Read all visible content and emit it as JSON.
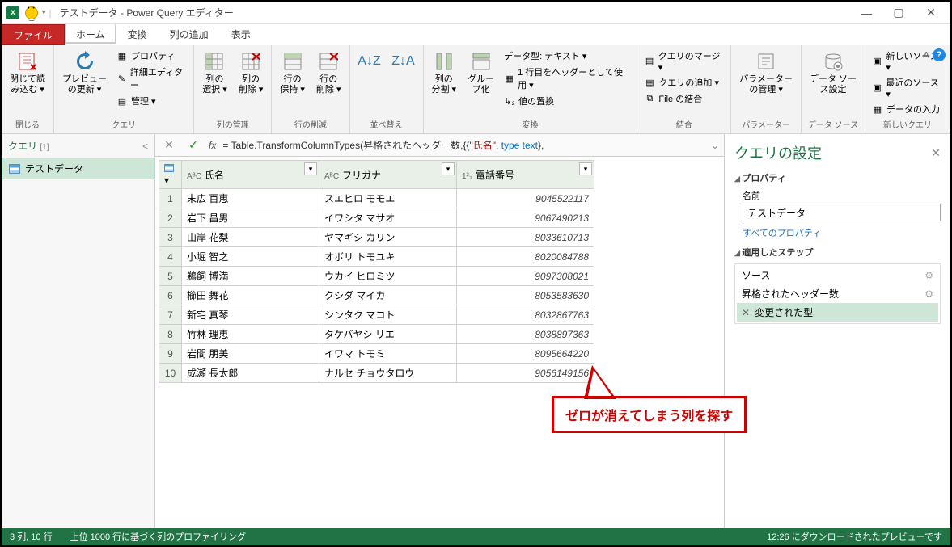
{
  "app": {
    "title": "テストデータ - Power Query エディター"
  },
  "win": {
    "min": "—",
    "max": "▢",
    "close": "✕"
  },
  "tabs": {
    "file": "ファイル",
    "home": "ホーム",
    "transform": "変換",
    "addcol": "列の追加",
    "view": "表示"
  },
  "ribbon": {
    "close": {
      "btn": "閉じて読\nみ込む ▾",
      "grp": "閉じる"
    },
    "query": {
      "refresh": "プレビュー\nの更新 ▾",
      "props": "プロパティ",
      "adv": "詳細エディター",
      "manage": "管理 ▾",
      "grp": "クエリ"
    },
    "cols": {
      "choose": "列の\n選択 ▾",
      "remove": "列の\n削除 ▾",
      "grp": "列の管理"
    },
    "rows": {
      "keep": "行の\n保持 ▾",
      "remove": "行の\n削除 ▾",
      "grp": "行の削減"
    },
    "sort": {
      "grp": "並べ替え"
    },
    "split": {
      "split": "列の\n分割 ▾",
      "group": "グルー\nプ化",
      "grp": "変換",
      "dtype": "データ型: テキスト ▾",
      "header": "1 行目をヘッダーとして使用 ▾",
      "replace": "値の置換"
    },
    "combine": {
      "merge": "クエリのマージ ▾",
      "append": "クエリの追加 ▾",
      "files": "File の結合",
      "grp": "結合"
    },
    "param": {
      "btn": "パラメーター\nの管理 ▾",
      "grp": "パラメーター"
    },
    "ds": {
      "btn": "データ ソー\nス設定",
      "grp": "データ ソース"
    },
    "newq": {
      "new": "新しいソース ▾",
      "recent": "最近のソース ▾",
      "enter": "データの入力",
      "grp": "新しいクエリ"
    }
  },
  "leftpanel": {
    "title": "クエリ",
    "count": "[1]",
    "item": "テストデータ",
    "collapse": "<"
  },
  "formula": {
    "text_pre": "= Table.TransformColumnTypes(昇格されたヘッダー数,{{",
    "quoted": "\"氏名\"",
    "text_mid": ", ",
    "keyword": "type text",
    "text_post": "},"
  },
  "grid": {
    "col1": "氏名",
    "col2": "フリガナ",
    "col3": "電話番号",
    "type_abc": "AᴮC",
    "type_123": "1²₃",
    "rows": [
      {
        "n": "1",
        "a": "末広 百恵",
        "b": "スエヒロ モモエ",
        "c": "9045522117"
      },
      {
        "n": "2",
        "a": "岩下 昌男",
        "b": "イワシタ マサオ",
        "c": "9067490213"
      },
      {
        "n": "3",
        "a": "山岸 花梨",
        "b": "ヤマギシ カリン",
        "c": "8033610713"
      },
      {
        "n": "4",
        "a": "小堀 智之",
        "b": "オボリ トモユキ",
        "c": "8020084788"
      },
      {
        "n": "5",
        "a": "鵜飼 博満",
        "b": "ウカイ ヒロミツ",
        "c": "9097308021"
      },
      {
        "n": "6",
        "a": "櫛田 舞花",
        "b": "クシダ マイカ",
        "c": "8053583630"
      },
      {
        "n": "7",
        "a": "新宅 真琴",
        "b": "シンタク マコト",
        "c": "8032867763"
      },
      {
        "n": "8",
        "a": "竹林 理恵",
        "b": "タケバヤシ リエ",
        "c": "8038897363"
      },
      {
        "n": "9",
        "a": "岩間 朋美",
        "b": "イワマ トモミ",
        "c": "8095664220"
      },
      {
        "n": "10",
        "a": "成瀬 長太郎",
        "b": "ナルセ チョウタロウ",
        "c": "9056149156"
      }
    ]
  },
  "settings": {
    "title": "クエリの設定",
    "props": "プロパティ",
    "name_lbl": "名前",
    "name_val": "テストデータ",
    "allprops": "すべてのプロパティ",
    "steps_h": "適用したステップ",
    "steps": [
      {
        "t": "ソース",
        "gear": true
      },
      {
        "t": "昇格されたヘッダー数",
        "gear": true
      },
      {
        "t": "変更された型",
        "active": true,
        "del": true
      }
    ]
  },
  "status": {
    "left": "3 列, 10 行　　上位 1000 行に基づく列のプロファイリング",
    "right": "12:26 にダウンロードされたプレビューです"
  },
  "callout": {
    "text": "ゼロが消えてしまう列を探す"
  }
}
